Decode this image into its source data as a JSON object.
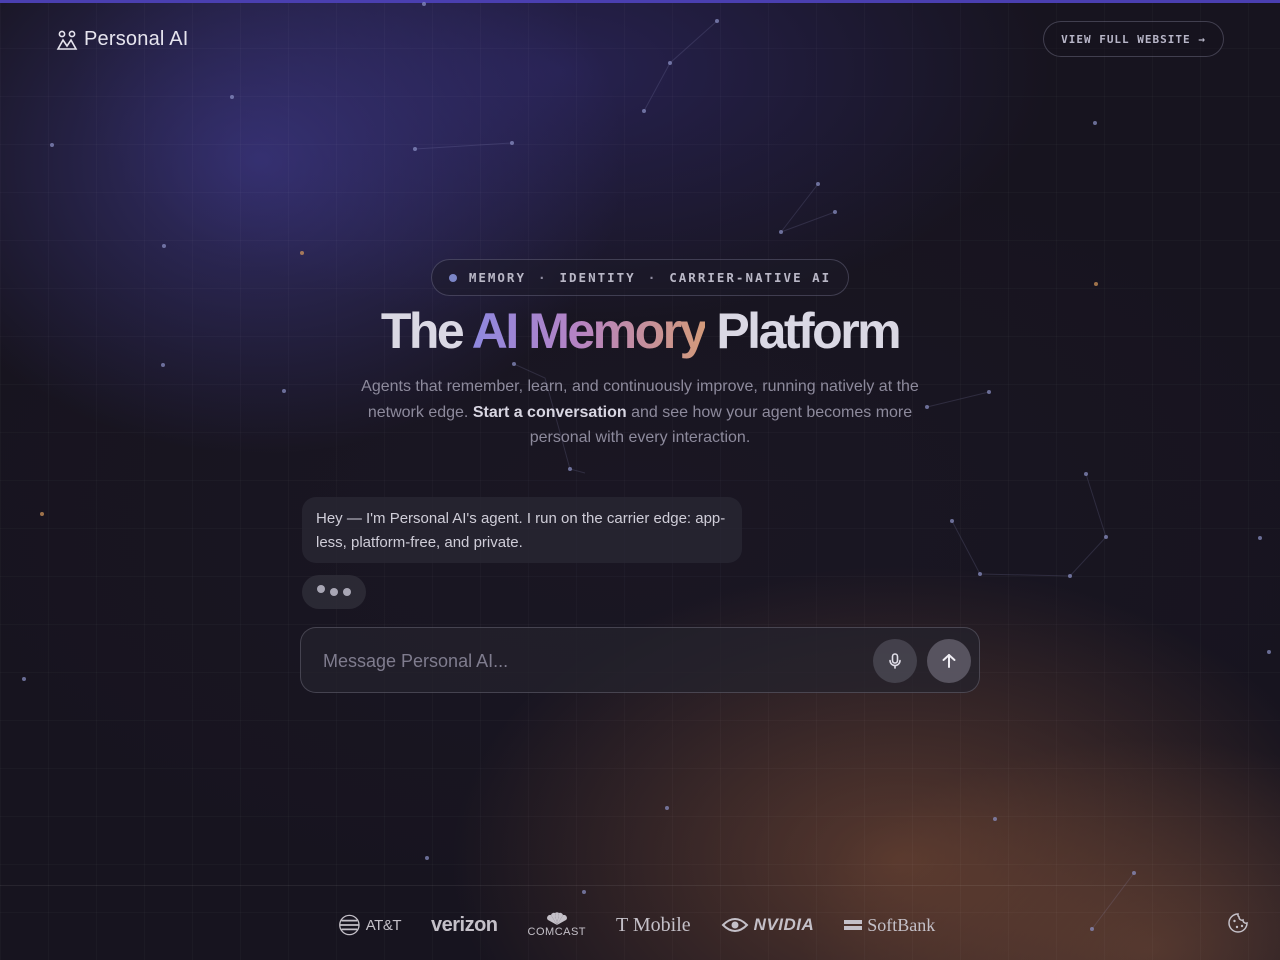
{
  "header": {
    "logo_text": "Personal AI",
    "site_button_label": "VIEW FULL WEBSITE →"
  },
  "hero": {
    "tags": [
      "MEMORY",
      "IDENTITY",
      "CARRIER-NATIVE AI"
    ],
    "separator": "·",
    "headline_start": "The",
    "headline_highlight": "AI Memory",
    "headline_end": "Platform",
    "sub_start": "Agents that remember, learn, and continuously improve, running natively at the network edge.",
    "sub_bold": "Start a conversation",
    "sub_end": "and see how your agent becomes more personal with every interaction."
  },
  "chat": {
    "agent_message": "Hey — I'm Personal AI's agent. I run on the carrier edge: app-less, platform-free, and private.",
    "input_placeholder": "Message Personal AI..."
  },
  "footer": {
    "partners": [
      "AT&T",
      "verizon",
      "COMCAST",
      "T Mobile",
      "NVIDIA",
      "SoftBank"
    ]
  },
  "icons": {
    "logo": "people-icon",
    "mic": "microphone-icon",
    "send": "arrow-up-icon",
    "cookie": "cookie-icon"
  },
  "colors": {
    "accent_start": "#8e88e0",
    "accent_mid": "#b583c4",
    "accent_end": "#d39a7a",
    "top_line": "#4a3fb0"
  }
}
